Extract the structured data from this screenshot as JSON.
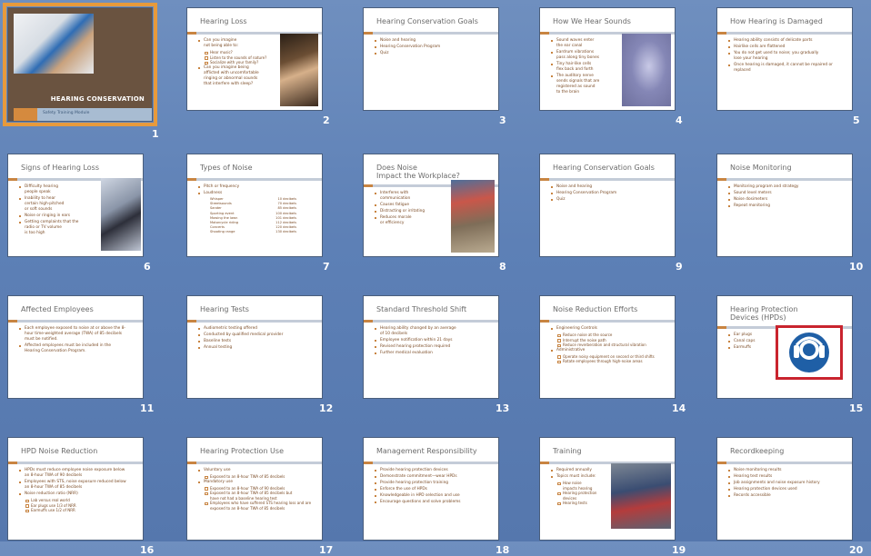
{
  "slides": [
    {
      "number": "1",
      "title": "HEARING CONSERVATION",
      "subtitle": "Safety Training Module"
    },
    {
      "number": "2",
      "title": "Hearing Loss",
      "bullets": [
        {
          "text": "Can you imagine\nnot being able to:",
          "sub": [
            "Hear music?",
            "Listen to the sounds of nature?",
            "Socialize with your family?"
          ]
        },
        {
          "text": "Can you imagine being\nafflicted with uncomfortable\nringing or abnormal sounds\nthat interfere with sleep?"
        }
      ]
    },
    {
      "number": "3",
      "title": "Hearing Conservation Goals",
      "bullets": [
        {
          "text": "Noise and hearing"
        },
        {
          "text": "Hearing Conservation Program"
        },
        {
          "text": "Quiz"
        }
      ]
    },
    {
      "number": "4",
      "title": "How We Hear Sounds",
      "bullets": [
        {
          "text": "Sound waves enter\nthe ear canal"
        },
        {
          "text": "Eardrum vibrations\npass along tiny bones"
        },
        {
          "text": "Tiny hair-like cells\nflex back and forth"
        },
        {
          "text": "The auditory nerve\nsends signals that are\nregistered as sound\nto the brain"
        }
      ]
    },
    {
      "number": "5",
      "title": "How Hearing is Damaged",
      "bullets": [
        {
          "text": "Hearing ability consists of delicate parts"
        },
        {
          "text": "Hairlike cells are flattened"
        },
        {
          "text": "You do not get used to noise; you gradually\nlose your hearing"
        },
        {
          "text": "Once hearing is damaged, it cannot be repaired or\nreplaced"
        }
      ]
    },
    {
      "number": "6",
      "title": "Signs of Hearing Loss",
      "bullets": [
        {
          "text": "Difficulty hearing\npeople speak"
        },
        {
          "text": "Inability to hear\ncertain high-pitched\nor soft sounds"
        },
        {
          "text": "Noise or ringing in ears"
        },
        {
          "text": "Getting complaints that the\nradio or TV volume\nis too high"
        }
      ]
    },
    {
      "number": "7",
      "title": "Types of Noise",
      "bullets": [
        {
          "text": "Pitch or frequency"
        },
        {
          "text": "Loudness",
          "table": [
            [
              "Whisper",
              "10 decibels"
            ],
            [
              "Streetsounds",
              "70 decibels"
            ],
            [
              "Sander",
              "85 decibels"
            ],
            [
              "Sporting event",
              "100 decibels"
            ],
            [
              "Mowing the lawn",
              "101 decibels"
            ],
            [
              "Motorcycle riding",
              "112 decibels"
            ],
            [
              "Concerts",
              "120 decibels"
            ],
            [
              "Shooting range",
              "130 decibels"
            ]
          ]
        }
      ]
    },
    {
      "number": "8",
      "title": "Does Noise\nImpact the Workplace?",
      "bullets": [
        {
          "text": "Interferes with\ncommunication"
        },
        {
          "text": "Causes fatigue"
        },
        {
          "text": "Distracting or irritating"
        },
        {
          "text": "Reduces morale\nor efficiency"
        }
      ]
    },
    {
      "number": "9",
      "title": "Hearing Conservation Goals",
      "bullets": [
        {
          "text": "Noise and hearing"
        },
        {
          "text": "Hearing Conservation Program"
        },
        {
          "text": "Quiz"
        }
      ]
    },
    {
      "number": "10",
      "title": "Noise Monitoring",
      "bullets": [
        {
          "text": "Monitoring program and strategy"
        },
        {
          "text": "Sound level meters"
        },
        {
          "text": "Noise dosimeters"
        },
        {
          "text": "Repeat monitoring"
        }
      ]
    },
    {
      "number": "11",
      "title": "Affected Employees",
      "bullets": [
        {
          "text": "Each employee exposed to noise at or above the 8-\nhour time-weighted average (TWA) of 85 decibels\nmust be notified."
        },
        {
          "text": "Affected employees must be included in the\nHearing Conservation Program."
        }
      ]
    },
    {
      "number": "12",
      "title": "Hearing Tests",
      "bullets": [
        {
          "text": "Audiometric testing offered"
        },
        {
          "text": "Conducted by qualified medical provider"
        },
        {
          "text": "Baseline tests"
        },
        {
          "text": "Annual testing"
        }
      ]
    },
    {
      "number": "13",
      "title": "Standard Threshold Shift",
      "bullets": [
        {
          "text": "Hearing ability changed by an average\nof 10 decibels"
        },
        {
          "text": "Employee notification within 21 days"
        },
        {
          "text": "Revised hearing protection required"
        },
        {
          "text": "Further medical evaluation"
        }
      ]
    },
    {
      "number": "14",
      "title": "Noise Reduction Efforts",
      "bullets": [
        {
          "text": "Engineering Controls",
          "sub": [
            "Reduce noise at the source",
            "Interrupt the noise path",
            "Reduce reverberation and structural vibration"
          ]
        },
        {
          "text": "Administrative",
          "sub": [
            "Operate noisy equipment on second or third shifts",
            "Rotate employees through high-noise areas"
          ]
        }
      ]
    },
    {
      "number": "15",
      "title": "Hearing Protection\nDevices (HPDs)",
      "bullets": [
        {
          "text": "Ear plugs"
        },
        {
          "text": "Canal caps"
        },
        {
          "text": "Earmuffs"
        }
      ]
    },
    {
      "number": "16",
      "title": "HPD Noise Reduction",
      "bullets": [
        {
          "text": "HPDs must reduce employee noise exposure below\nan 8-hour TWA of 90 decibels"
        },
        {
          "text": "Employees with STS, noise exposure reduced below\nan 8-hour TWA of 85 decibels"
        },
        {
          "text": "Noise reduction ratio (NRR)",
          "sub": [
            "Lab versus real world",
            "Ear plugs use 1/3 of NRR",
            "Earmuffs use 1/2 of NRR"
          ]
        }
      ]
    },
    {
      "number": "17",
      "title": "Hearing Protection Use",
      "bullets": [
        {
          "text": "Voluntary use",
          "sub": [
            "Exposed to an 8-hour TWA of 85 decibels"
          ]
        },
        {
          "text": "Mandatory use",
          "sub": [
            "Exposed to an 8-hour TWA of 90 decibels",
            "Exposed to an 8-hour TWA of 85 decibels but\nhave not had a baseline hearing test",
            "Employees who have suffered STS hearing loss and are\nexposed to an 8-hour TWA of 85 decibels"
          ]
        }
      ]
    },
    {
      "number": "18",
      "title": "Management Responsibility",
      "bullets": [
        {
          "text": "Provide hearing protection devices"
        },
        {
          "text": "Demonstrate commitment—wear HPDs"
        },
        {
          "text": "Provide hearing protection training"
        },
        {
          "text": "Enforce the use of HPDs"
        },
        {
          "text": "Knowledgeable in HPD selection and use"
        },
        {
          "text": "Encourage questions and solve problems"
        }
      ]
    },
    {
      "number": "19",
      "title": "Training",
      "bullets": [
        {
          "text": "Required annually"
        },
        {
          "text": "Topics must include:",
          "sub": [
            "How noise\nimpacts hearing",
            "Hearing protection\ndevices",
            "Hearing tests"
          ]
        }
      ]
    },
    {
      "number": "20",
      "title": "Recordkeeping",
      "bullets": [
        {
          "text": "Noise monitoring results"
        },
        {
          "text": "Hearing test results"
        },
        {
          "text": "Job assignments and noise exposure history"
        },
        {
          "text": "Hearing protection devices used"
        },
        {
          "text": "Records accessible"
        }
      ]
    }
  ]
}
